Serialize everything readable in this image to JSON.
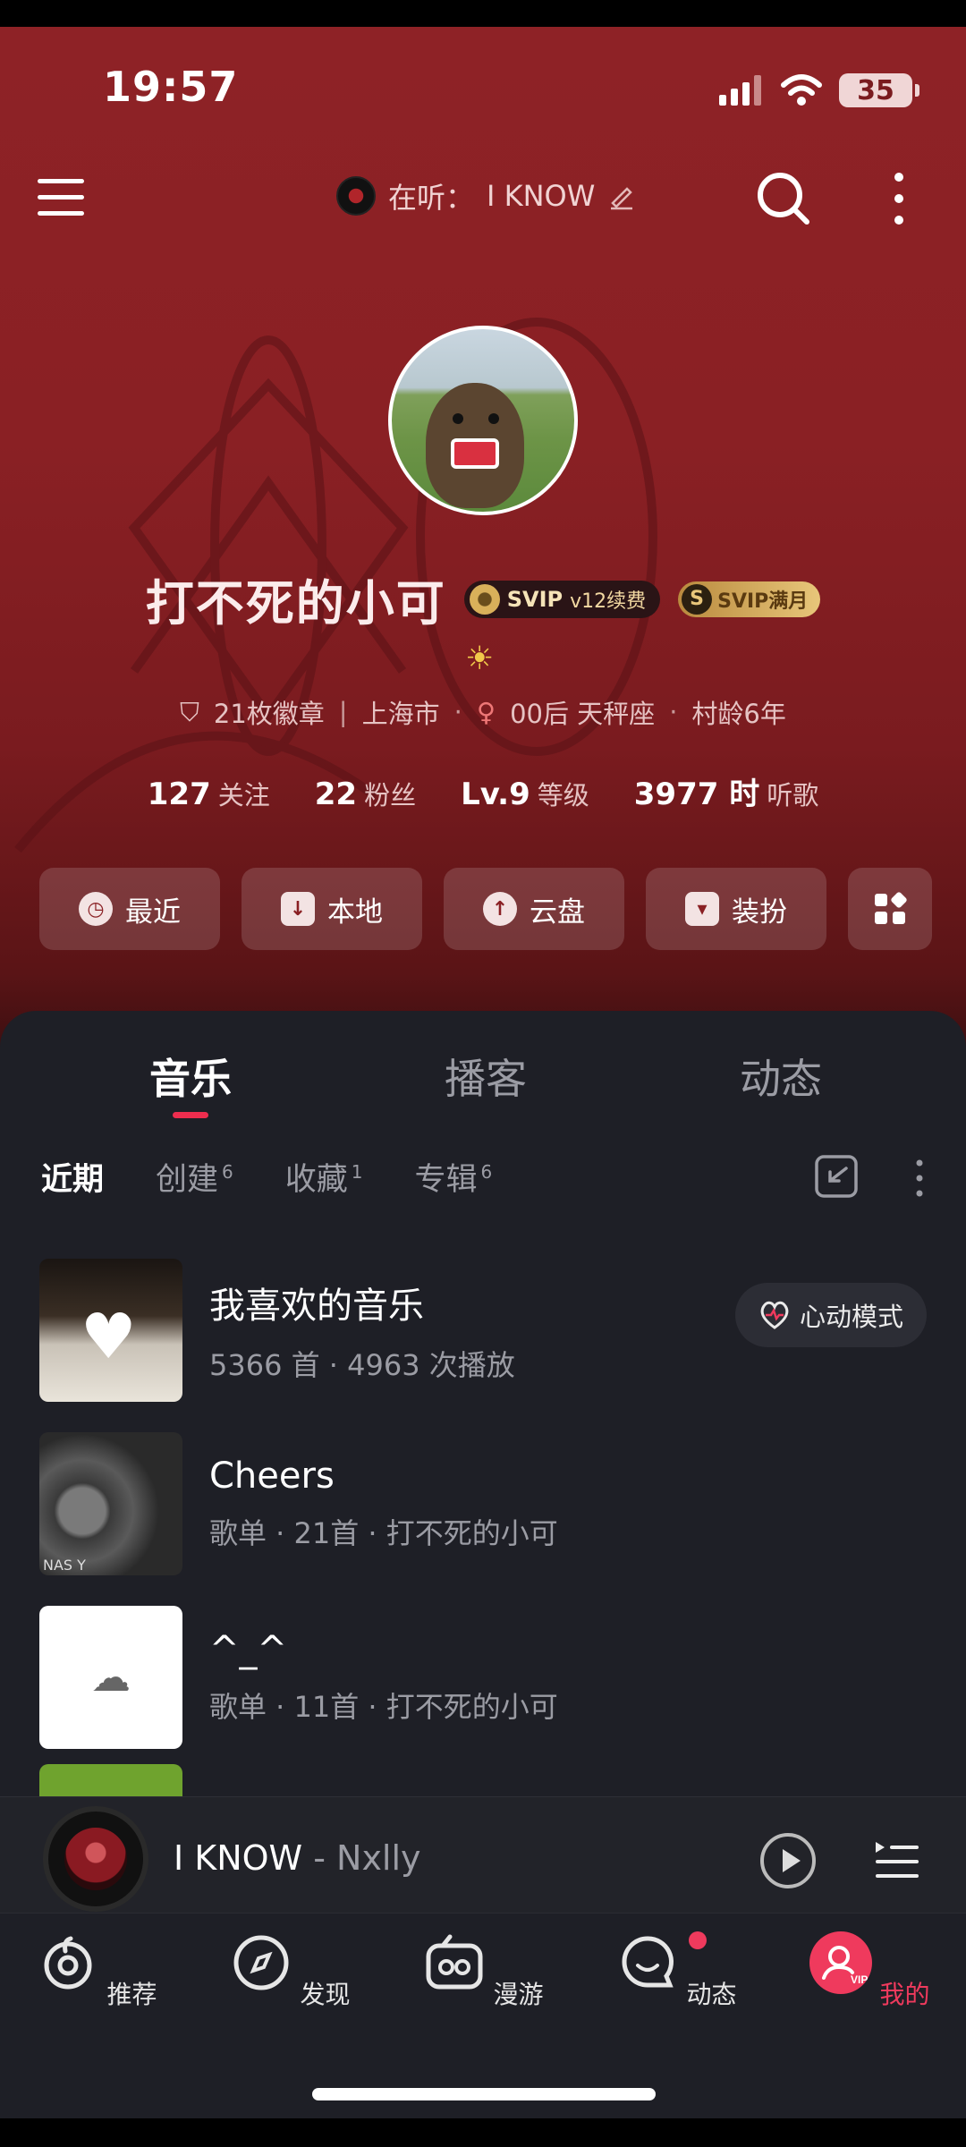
{
  "status_bar": {
    "time": "19:57",
    "battery": "35"
  },
  "top_nav": {
    "now_playing_prefix": "在听：",
    "now_playing_song": "I KNOW"
  },
  "profile": {
    "name": "打不死的小可",
    "svip_label": "SVIP",
    "svip_level": "v12续费",
    "svip_full": "SVIP满月",
    "badges": "21枚徽章",
    "city": "上海市",
    "age_zodiac": "00后 天秤座",
    "village_age": "村龄6年",
    "stats": [
      {
        "value": "127",
        "label": "关注"
      },
      {
        "value": "22",
        "label": "粉丝"
      },
      {
        "value": "Lv.9",
        "label": "等级"
      },
      {
        "value": "3977 时",
        "label": "听歌"
      }
    ]
  },
  "quick_actions": [
    {
      "label": "最近",
      "icon": "clock-icon"
    },
    {
      "label": "本地",
      "icon": "download-icon"
    },
    {
      "label": "云盘",
      "icon": "cloud-upload-icon"
    },
    {
      "label": "装扮",
      "icon": "shirt-icon"
    },
    {
      "label": "",
      "icon": "grid-icon"
    }
  ],
  "tabs": [
    "音乐",
    "播客",
    "动态"
  ],
  "subtabs": [
    {
      "label": "近期",
      "count": ""
    },
    {
      "label": "创建",
      "count": "6"
    },
    {
      "label": "收藏",
      "count": "1"
    },
    {
      "label": "专辑",
      "count": "6"
    }
  ],
  "playlists": [
    {
      "title": "我喜欢的音乐",
      "sub": "5366 首 · 4963 次播放",
      "action": "心动模式"
    },
    {
      "title": "Cheers",
      "sub": "歌单 · 21首 · 打不死的小可",
      "cover_text": "NAS Y"
    },
    {
      "title": "^_^",
      "sub": "歌单 · 11首 · 打不死的小可"
    }
  ],
  "mini_player": {
    "song": "I KNOW",
    "artist": "Nxlly"
  },
  "bottom_nav": [
    "推荐",
    "发现",
    "漫游",
    "动态",
    "我的"
  ],
  "colors": {
    "header_red": "#8e2226",
    "panel_dark": "#1e1f26",
    "accent_red": "#ef3a5d",
    "gold": "#e8c67a"
  }
}
